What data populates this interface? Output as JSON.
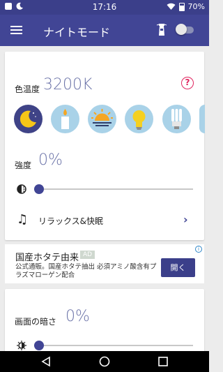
{
  "status_bar": {
    "time": "17:16",
    "battery": "70%"
  },
  "app_bar": {
    "title": "ナイトモード",
    "toggle_on": false
  },
  "color_temperature": {
    "label": "色温度",
    "value": "3200K",
    "presets": [
      {
        "name": "moon",
        "selected": true
      },
      {
        "name": "candle",
        "selected": false
      },
      {
        "name": "sunset",
        "selected": false
      },
      {
        "name": "bulb",
        "selected": false
      },
      {
        "name": "fluorescent",
        "selected": false
      }
    ]
  },
  "intensity": {
    "label": "強度",
    "value": "0%",
    "level": 0
  },
  "relax_sleep": {
    "label": "リラックス&快眠"
  },
  "ad": {
    "title": "国産ホタテ由来",
    "badge": "AD",
    "body": "公式通販。国産ホタテ抽出 必須アミノ酸含有プラズマローゲン配合",
    "button": "開く"
  },
  "screen_dim": {
    "label": "画面の暗さ",
    "value": "0%",
    "level": 0
  },
  "colors": {
    "primary": "#414595",
    "status_bar": "#3b3f8a",
    "value_text": "#6b73a8",
    "help_accent": "#e0245e",
    "preset_bg": "#a9d2e8"
  }
}
